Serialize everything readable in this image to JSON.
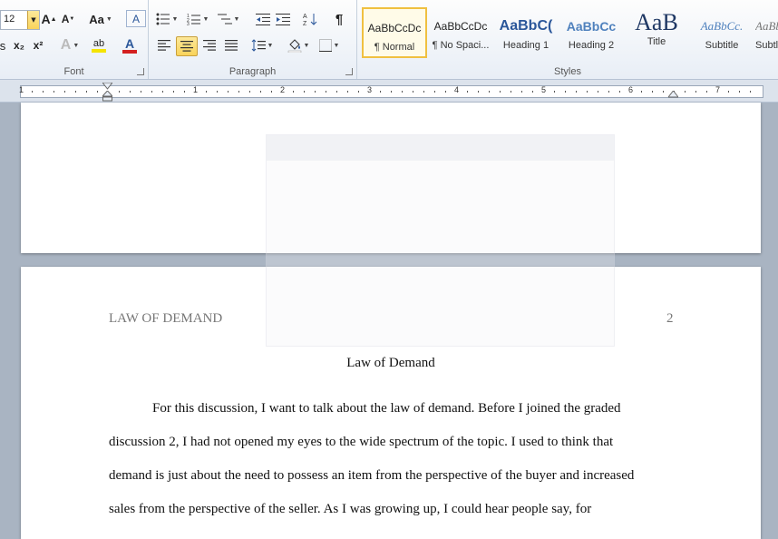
{
  "ribbon": {
    "font": {
      "label": "Font",
      "size_value": "12",
      "grow_label": "A",
      "shrink_label": "A",
      "case_label": "Aa",
      "clear_label": "A",
      "sub_label": "x₂",
      "sup_label": "x²",
      "effects_label": "A",
      "highlight_label": "ab",
      "color_label": "A"
    },
    "paragraph": {
      "label": "Paragraph",
      "pilcrow": "¶"
    },
    "styles": {
      "label": "Styles",
      "items": [
        {
          "sample": "AaBbCcDc",
          "name": "¶ Normal"
        },
        {
          "sample": "AaBbCcDc",
          "name": "¶ No Spaci..."
        },
        {
          "sample": "AaBbC(",
          "name": "Heading 1"
        },
        {
          "sample": "AaBbCc",
          "name": "Heading 2"
        },
        {
          "sample": "AaB",
          "name": "Title"
        },
        {
          "sample": "AaBbCc.",
          "name": "Subtitle"
        },
        {
          "sample": "AaBbCc",
          "name": "Subtle Em..."
        }
      ]
    },
    "colors": {
      "highlight": "#f5e400",
      "font_color": "#d42020",
      "accent_blue": "#2b579a"
    }
  },
  "ruler": {
    "numbers": [
      "1",
      "1",
      "2",
      "3",
      "4",
      "5",
      "6",
      "7"
    ]
  },
  "document": {
    "header_left": "LAW OF DEMAND",
    "header_right": "2",
    "title": "Law of Demand",
    "lines": [
      "For this discussion, I want to talk about the law of demand. Before I joined the graded",
      "discussion 2, I had not opened my eyes to the wide spectrum of the topic. I used to think that",
      "demand is just about the need to possess an item from the perspective of the buyer and increased",
      "sales from the perspective of the seller. As I was growing up, I could hear people say, for"
    ]
  }
}
